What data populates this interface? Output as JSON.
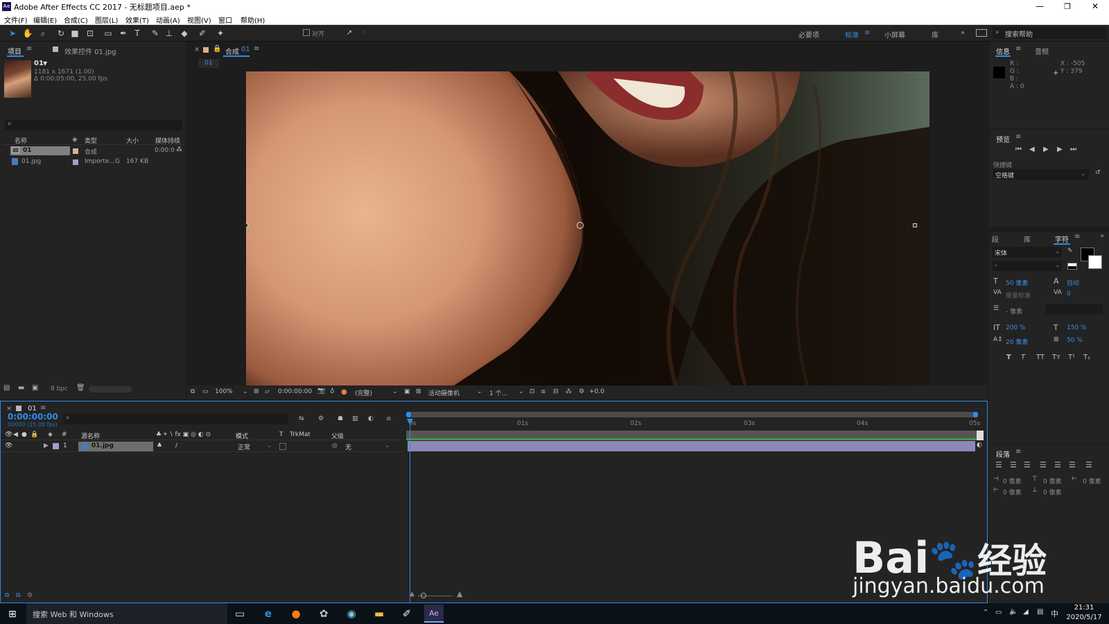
{
  "window": {
    "title": "Adobe After Effects CC 2017 - 无标题项目.aep *",
    "app_icon": "Ae",
    "minimize_glyph": "—",
    "restore_glyph": "❐",
    "close_glyph": "✕"
  },
  "menu": [
    "文件(F)",
    "编辑(E)",
    "合成(C)",
    "图层(L)",
    "效果(T)",
    "动画(A)",
    "视图(V)",
    "窗口",
    "帮助(H)"
  ],
  "toolbar": {
    "snap_label": "对齐",
    "workspaces": [
      "必要项",
      "标准",
      "小屏幕",
      "库"
    ],
    "active_workspace": "标准",
    "more": "»",
    "search_placeholder": "搜索帮助"
  },
  "project_panel": {
    "tab_project": "项目",
    "tab_effects": "效果控件 01.jpg",
    "item_name": "01",
    "item_dims": "1181 x 1671 (1.00)",
    "item_duration": "Δ 0:00:05:00, 25.00 fps",
    "columns": [
      "名称",
      "类型",
      "大小",
      "媒体持续"
    ],
    "rows": [
      {
        "name": "01",
        "type": "合成",
        "size": "",
        "duration": "0:00:0"
      },
      {
        "name": "01.jpg",
        "type": "Importe...G",
        "size": "167 KB",
        "duration": ""
      }
    ],
    "bpc": "8 bpc"
  },
  "comp_panel": {
    "tab_label": "合成",
    "tab_name": "01",
    "breadcrumb": "01",
    "zoom": "100%",
    "timecode": "0:00:00:00",
    "resolution": "(完整)",
    "camera": "活动摄像机",
    "views": "1 个...",
    "exposure": "+0.0"
  },
  "info_panel": {
    "tab_info": "信息",
    "tab_audio": "音频",
    "r": "R :",
    "g": "G :",
    "b": "B :",
    "a": "A : 0",
    "x": "X : -505",
    "y": "Y : 379"
  },
  "preview_panel": {
    "title": "预览",
    "shortcut_label": "快捷键",
    "shortcut_value": "空格键"
  },
  "character_panel": {
    "tabs": [
      "段",
      "库",
      "字符"
    ],
    "active_tab": "字符",
    "font": "宋体",
    "style": "-",
    "size": "50 像素",
    "leading": "自动",
    "kerning": "度量标准",
    "tracking": "0",
    "stroke": "- 像素",
    "vscale": "200 %",
    "hscale": "150 %",
    "baseline": "20 像素",
    "tsume": "50 %",
    "styles": [
      "T",
      "T",
      "TT",
      "Tт",
      "T¹",
      "T₁"
    ]
  },
  "paragraph_panel": {
    "title": "段落",
    "indent_left": "0 像素",
    "indent_right": "0 像素",
    "indent_first": "0 像素",
    "space_before": "0 像素",
    "space_after": "0 像素"
  },
  "timeline": {
    "tab_name": "01",
    "timecode": "0:00:00:00",
    "frame_info": "00000 (25.00 fps)",
    "columns": {
      "num": "#",
      "source": "源名称",
      "mode": "模式",
      "t": "T",
      "trkmat": "TrkMat",
      "parent": "父级"
    },
    "ruler": [
      "0s",
      "01s",
      "02s",
      "03s",
      "04s",
      "05s"
    ],
    "layer": {
      "index": "1",
      "name": "01.jpg",
      "mode": "正常",
      "parent": "无"
    }
  },
  "taskbar": {
    "search_text": "搜索 Web 和 Windows",
    "time": "21:31",
    "date": "2020/5/17",
    "ime": "中"
  },
  "watermark": {
    "brand": "Bai",
    "brand_cn": "经验",
    "url": "jingyan.baidu.com"
  },
  "colors": {
    "accent": "#2d8ceb",
    "panel_bg": "#232323",
    "layer_bar": "#8f87b8",
    "work_area": "#3e9e3e"
  }
}
